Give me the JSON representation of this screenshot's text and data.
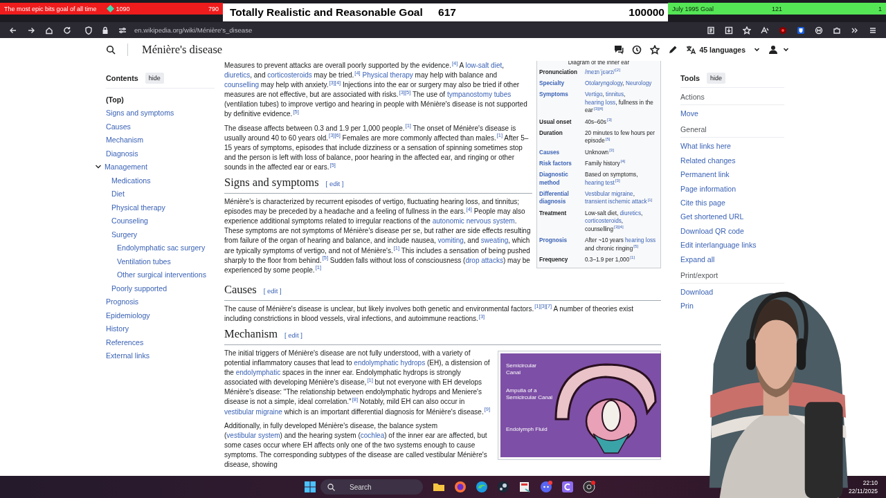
{
  "stream_goals": [
    {
      "kind": "bits",
      "color": "#ee1c1c",
      "title": "The most epic bits goal of all time",
      "count": "1090",
      "total": "790"
    },
    {
      "kind": "plain",
      "color": "#ffffff",
      "title": "Totally Realistic and Reasonable Goal",
      "count": "617",
      "total": "100000"
    },
    {
      "kind": "plain",
      "color": "#55e655",
      "title": "July 1995 Goal",
      "count": "121",
      "total": "1"
    }
  ],
  "browser": {
    "url": "en.wikipedia.org/wiki/Ménière's_disease"
  },
  "wiki_header": {
    "title": "Ménière's disease",
    "languages": "45 languages"
  },
  "toc": {
    "heading": "Contents",
    "hide": "hide",
    "items": [
      {
        "label": "(Top)",
        "selected": true
      },
      {
        "label": "Signs and symptoms",
        "selected": false
      },
      {
        "label": "Causes",
        "selected": false
      },
      {
        "label": "Mechanism",
        "selected": false
      },
      {
        "label": "Diagnosis",
        "selected": false
      },
      {
        "label": "Management",
        "selected": false,
        "expanded": true,
        "children": [
          {
            "label": "Medications",
            "selected": false
          },
          {
            "label": "Diet",
            "selected": false
          },
          {
            "label": "Physical therapy",
            "selected": false
          },
          {
            "label": "Counseling",
            "selected": false
          },
          {
            "label": "Surgery",
            "selected": false,
            "children": [
              {
                "label": "Endolymphatic sac surgery",
                "selected": false
              },
              {
                "label": "Ventilation tubes",
                "selected": false
              },
              {
                "label": "Other surgical interventions",
                "selected": false
              }
            ]
          },
          {
            "label": "Poorly supported",
            "selected": false
          }
        ]
      },
      {
        "label": "Prognosis",
        "selected": false
      },
      {
        "label": "Epidemiology",
        "selected": false
      },
      {
        "label": "History",
        "selected": false
      },
      {
        "label": "References",
        "selected": false
      },
      {
        "label": "External links",
        "selected": false
      }
    ]
  },
  "infobox": {
    "caption": "Diagram of the inner ear",
    "rows": [
      {
        "label": "Pronunciation",
        "label_link": false,
        "value": [
          {
            "text": "/meɪnˈjɛərz/",
            "link": true
          },
          {
            "text": "$^{[2]}$",
            "link": false
          }
        ]
      },
      {
        "label": "Specialty",
        "label_link": true,
        "value": [
          {
            "text": "Otolaryngology",
            "link": true
          },
          {
            "text": ", ",
            "link": false
          },
          {
            "text": "Neurology",
            "link": true
          }
        ]
      },
      {
        "label": "Symptoms",
        "label_link": true,
        "value": [
          {
            "text": "Vertigo",
            "link": true
          },
          {
            "text": ", ",
            "link": false
          },
          {
            "text": "tinnitus",
            "link": true
          },
          {
            "text": ", ",
            "link": false
          },
          {
            "text": "hearing loss",
            "link": true
          },
          {
            "text": ", fullness in the ear$^{[3][4]}$",
            "link": false
          }
        ]
      },
      {
        "label": "Usual onset",
        "label_link": false,
        "value": [
          {
            "text": "40s–60s$^{[3]}$",
            "link": false
          }
        ]
      },
      {
        "label": "Duration",
        "label_link": false,
        "value": [
          {
            "text": "20 minutes to few hours per episode$^{[5]}$",
            "link": false
          }
        ]
      },
      {
        "label": "Causes",
        "label_link": true,
        "value": [
          {
            "text": "Unknown$^{[3]}$",
            "link": false
          }
        ]
      },
      {
        "label": "Risk factors",
        "label_link": true,
        "value": [
          {
            "text": "Family history$^{[4]}$",
            "link": false
          }
        ]
      },
      {
        "label": "Diagnostic method",
        "label_link": true,
        "value": [
          {
            "text": "Based on symptoms, ",
            "link": false
          },
          {
            "text": "hearing test",
            "link": true
          },
          {
            "text": "$^{[3]}$",
            "link": false
          }
        ]
      },
      {
        "label": "Differential diagnosis",
        "label_link": true,
        "value": [
          {
            "text": "Vestibular migraine",
            "link": true
          },
          {
            "text": ", ",
            "link": false
          },
          {
            "text": "transient ischemic attack",
            "link": true
          },
          {
            "text": "$^{[1]}$",
            "link": false
          }
        ]
      },
      {
        "label": "Treatment",
        "label_link": false,
        "value": [
          {
            "text": "Low-salt diet, ",
            "link": false
          },
          {
            "text": "diuretics",
            "link": true
          },
          {
            "text": ", ",
            "link": false
          },
          {
            "text": "corticosteroids",
            "link": true
          },
          {
            "text": ", counselling$^{[3][4]}$",
            "link": false
          }
        ]
      },
      {
        "label": "Prognosis",
        "label_link": true,
        "value": [
          {
            "text": "After ~10 years ",
            "link": false
          },
          {
            "text": "hearing loss",
            "link": true
          },
          {
            "text": " and chronic ringing$^{[5]}$",
            "link": false
          }
        ]
      },
      {
        "label": "Frequency",
        "label_link": false,
        "value": [
          {
            "text": "0.3–1.9 per 1,000$^{[1]}$",
            "link": false
          }
        ]
      }
    ]
  },
  "lead": [
    [
      {
        "text": "Measures to prevent attacks are overall poorly supported by the evidence.$^{[4]}$ A ",
        "link": false
      },
      {
        "text": "low-salt diet",
        "link": true
      },
      {
        "text": ", ",
        "link": false
      },
      {
        "text": "diuretics",
        "link": true
      },
      {
        "text": ", and ",
        "link": false
      },
      {
        "text": "corticosteroids",
        "link": true
      },
      {
        "text": " may be tried.$^{[4]}$ ",
        "link": false
      },
      {
        "text": "Physical therapy",
        "link": true
      },
      {
        "text": " may help with balance and ",
        "link": false
      },
      {
        "text": "counselling",
        "link": true
      },
      {
        "text": " may help with anxiety.$^{[3][4]}$ Injections into the ear or surgery may also be tried if other measures are not effective, but are associated with risks.$^{[3][5]}$ The use of ",
        "link": false
      },
      {
        "text": "tympanostomy tubes",
        "link": true
      },
      {
        "text": " (ventilation tubes) to improve vertigo and hearing in people with Ménière's disease is not supported by definitive evidence.$^{[5]}$",
        "link": false
      }
    ],
    [
      {
        "text": "The disease affects between 0.3 and 1.9 per 1,000 people.$^{[1]}$ The onset of Ménière's disease is usually around 40 to 60 years old.$^{[3][6]}$ Females are more commonly affected than males.$^{[1]}$ After 5–15 years of symptoms, episodes that include dizziness or a sensation of spinning sometimes stop and the person is left with loss of balance, poor hearing in the affected ear, and ringing or other sounds in the affected ear or ears.$^{[5]}$",
        "link": false
      }
    ]
  ],
  "sections": [
    {
      "heading": "Signs and symptoms",
      "edit": "[ edit ]",
      "paragraphs": [
        [
          {
            "text": "Ménière's is characterized by recurrent episodes of vertigo, fluctuating hearing loss, and tinnitus; episodes may be preceded by a headache and a feeling of fullness in the ears.$^{[4]}$ People may also experience additional symptoms related to irregular reactions of the ",
            "link": false
          },
          {
            "text": "autonomic nervous system",
            "link": true
          },
          {
            "text": ". These symptoms are not symptoms of Ménière's disease per se, but rather are side effects resulting from failure of the organ of hearing and balance, and include nausea, ",
            "link": false
          },
          {
            "text": "vomiting",
            "link": true
          },
          {
            "text": ", and ",
            "link": false
          },
          {
            "text": "sweating",
            "link": true
          },
          {
            "text": ", which are typically symptoms of vertigo, and not of Ménière's.$^{[1]}$ This includes a sensation of being pushed sharply to the floor from behind.$^{[5]}$ Sudden falls without loss of consciousness (",
            "link": false
          },
          {
            "text": "drop attacks",
            "link": true
          },
          {
            "text": ") may be experienced by some people.$^{[1]}$",
            "link": false
          }
        ]
      ]
    },
    {
      "heading": "Causes",
      "edit": "[ edit ]",
      "paragraphs": [
        [
          {
            "text": "The cause of Ménière's disease is unclear, but likely involves both genetic and environmental factors.$^{[1][3][7]}$ A number of theories exist including constrictions in blood vessels, viral infections, and autoimmune reactions.$^{[3]}$",
            "link": false
          }
        ]
      ]
    },
    {
      "heading": "Mechanism",
      "edit": "[ edit ]",
      "figure": {
        "labels": [
          "Semicircular Canal",
          "Ampulla of a Semicircular Canal",
          "Endolymph Fluid"
        ]
      },
      "paragraphs": [
        [
          {
            "text": "The initial triggers of Ménière's disease are not fully understood, with a variety of potential inflammatory causes that lead to ",
            "link": false
          },
          {
            "text": "endolymphatic hydrops",
            "link": true
          },
          {
            "text": " (EH), a distension of the ",
            "link": false
          },
          {
            "text": "endolymphatic",
            "link": true
          },
          {
            "text": " spaces in the inner ear. Endolymphatic hydrops is strongly associated with developing Ménière's disease,$^{[1]}$ but not everyone with EH develops Ménière's disease: \"The relationship between endolymphatic hydrops and Meniere's disease is not a simple, ideal correlation.\"$^{[8]}$ Notably, mild EH can also occur in ",
            "link": false
          },
          {
            "text": "vestibular migraine",
            "link": true
          },
          {
            "text": " which is an important differential diagnosis for Ménière's disease.$^{[9]}$",
            "link": false
          }
        ],
        [
          {
            "text": "Additionally, in fully developed Ménière's disease, the balance system (",
            "link": false
          },
          {
            "text": "vestibular system",
            "link": true
          },
          {
            "text": ") and the hearing system (",
            "link": false
          },
          {
            "text": "cochlea",
            "link": true
          },
          {
            "text": ") of the inner ear are affected, but some cases occur where EH affects only one of the two systems enough to cause symptoms. The corresponding subtypes of the disease are called vestibular Ménière's disease, showing",
            "link": false
          }
        ]
      ]
    }
  ],
  "tools": {
    "heading": "Tools",
    "hide": "hide",
    "sections": [
      {
        "heading": "Actions",
        "items": [
          "Move"
        ]
      },
      {
        "heading": "General",
        "items": [
          "What links here",
          "Related changes",
          "Permanent link",
          "Page information",
          "Cite this page",
          "Get shortened URL",
          "Download QR code",
          "Edit interlanguage links",
          "Expand all"
        ]
      },
      {
        "heading": "Print/export",
        "items": [
          "Download",
          "Prin"
        ]
      }
    ]
  },
  "taskbar": {
    "search": "Search",
    "time": "22:10",
    "date": "22/11/2025"
  }
}
